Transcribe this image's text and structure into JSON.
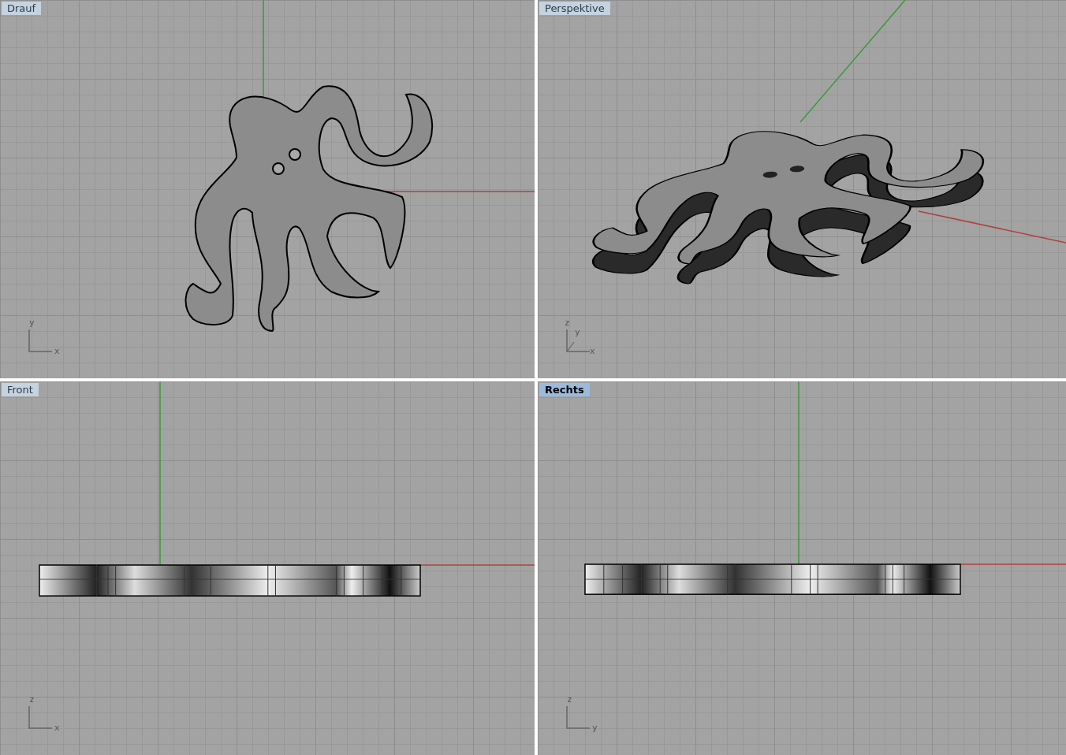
{
  "viewports": [
    {
      "kind": "top",
      "label": "Drauf",
      "selected": false,
      "axes": [
        "y",
        "x"
      ]
    },
    {
      "kind": "perspective",
      "label": "Perspektive",
      "selected": false,
      "axes": [
        "z",
        "y",
        "x"
      ]
    },
    {
      "kind": "front",
      "label": "Front",
      "selected": false,
      "axes": [
        "z",
        "x"
      ]
    },
    {
      "kind": "right",
      "label": "Rechts",
      "selected": true,
      "axes": [
        "z",
        "y"
      ]
    }
  ]
}
